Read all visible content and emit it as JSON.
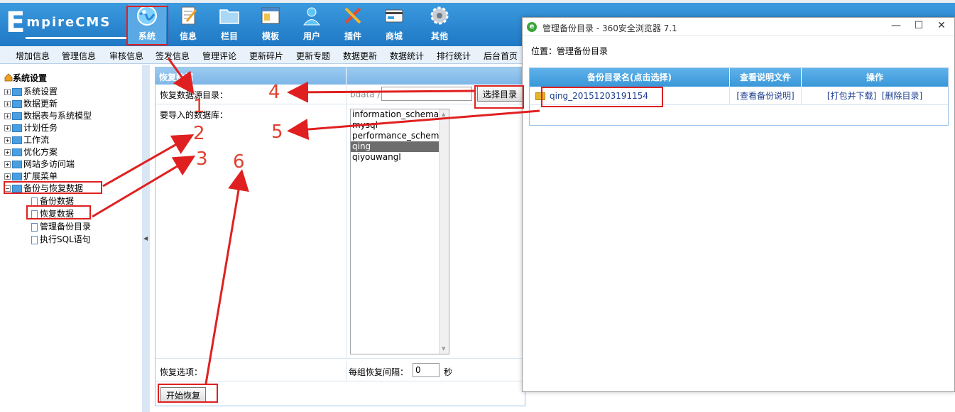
{
  "logo": {
    "big": "E",
    "rest": "mpireCMS"
  },
  "nav": [
    {
      "label": "系统",
      "icon": "globe-icon"
    },
    {
      "label": "信息",
      "icon": "document-pen-icon"
    },
    {
      "label": "栏目",
      "icon": "folder-icon"
    },
    {
      "label": "模板",
      "icon": "window-template-icon"
    },
    {
      "label": "用户",
      "icon": "user-icon"
    },
    {
      "label": "插件",
      "icon": "tools-icon"
    },
    {
      "label": "商城",
      "icon": "shop-card-icon"
    },
    {
      "label": "其他",
      "icon": "gear-icon"
    }
  ],
  "submenu": [
    "增加信息",
    "管理信息",
    "审核信息",
    "签发信息",
    "管理评论",
    "更新碎片",
    "更新专题",
    "数据更新",
    "数据统计",
    "排行统计",
    "后台首页"
  ],
  "tree": {
    "title": "系统设置",
    "items": [
      {
        "label": "系统设置"
      },
      {
        "label": "数据更新"
      },
      {
        "label": "数据表与系统模型"
      },
      {
        "label": "计划任务"
      },
      {
        "label": "工作流"
      },
      {
        "label": "优化方案"
      },
      {
        "label": "网站多访问端"
      },
      {
        "label": "扩展菜单"
      },
      {
        "label": "备份与恢复数据"
      }
    ],
    "children": [
      {
        "label": "备份数据"
      },
      {
        "label": "恢复数据"
      },
      {
        "label": "管理备份目录"
      },
      {
        "label": "执行SQL语句"
      }
    ]
  },
  "form": {
    "title": "恢复数据",
    "source_label": "恢复数据源目录：",
    "path_prefix": "bdata /",
    "path_value": "",
    "choose_button": "选择目录",
    "db_label": "要导入的数据库：",
    "databases": [
      "information_schema",
      "mysql",
      "performance_schema",
      "qing",
      "qiyouwangl"
    ],
    "selected_db": "qing",
    "options_label": "恢复选项：",
    "interval_label": "每组恢复间隔：",
    "interval_value": "0",
    "interval_unit": "秒",
    "start_button": "开始恢复"
  },
  "popup": {
    "title": "管理备份目录 - 360安全浏览器 7.1",
    "location": "位置：管理备份目录",
    "columns": [
      "备份目录名(点击选择)",
      "查看说明文件",
      "操作"
    ],
    "rows": [
      {
        "dir": "qing_20151203191154",
        "readme": "[查看备份说明]",
        "actions": "[打包并下载]  [删除目录]"
      }
    ],
    "win_min": "—",
    "win_max": "☐",
    "win_close": "✕"
  },
  "annotations": [
    "1",
    "2",
    "3",
    "4",
    "5",
    "6"
  ],
  "colors": {
    "header": "#1f78c4",
    "highlight": "#e02020",
    "table_header": "#3a97d8"
  }
}
